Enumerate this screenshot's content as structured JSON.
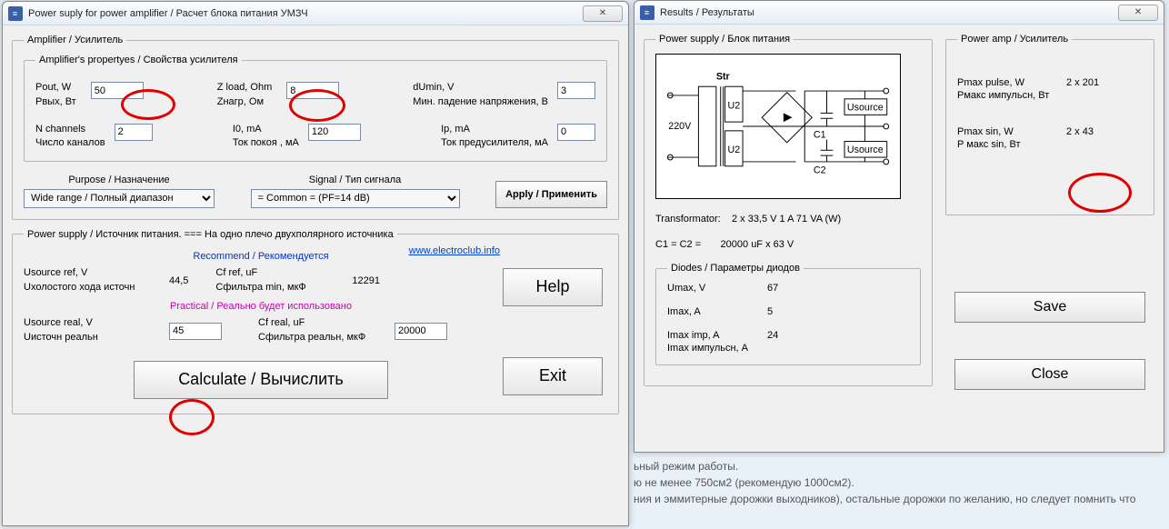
{
  "bg": {
    "line1": "ьный режим работы.",
    "line2": "ю не менее 750см2 (рекомендую 1000см2).",
    "line3": "ния и эммитерные дорожки выходников), остальные дорожки по желанию, но следует помнить что"
  },
  "win1": {
    "title": "Power suply for power amplifier / Расчет блока питания УМЗЧ",
    "close": "✕",
    "amp": {
      "legend": "Amplifier / Усилитель",
      "props_legend": "Amplifier's propertyes / Свойства усилителя",
      "pout_l1": "Pout, W",
      "pout_l2": "Pвых, Вт",
      "pout_val": "50",
      "zload_l1": "Z load, Ohm",
      "zload_l2": "Zнагр, Ом",
      "zload_val": "8",
      "dumin_l1": "dUmin, V",
      "dumin_l2": "Мин. падение напряжения, В",
      "dumin_val": "3",
      "nch_l1": "N channels",
      "nch_l2": "Число каналов",
      "nch_val": "2",
      "i0_l1": "I0, mA",
      "i0_l2": "Ток покоя , мА",
      "i0_val": "120",
      "ip_l1": "Ip, mA",
      "ip_l2": "Ток предусилителя, мА",
      "ip_val": "0",
      "purpose_lbl": "Purpose / Назначение",
      "purpose_sel": "Wide range / Полный диапазон",
      "signal_lbl": "Signal / Тип сигнала",
      "signal_sel": "= Common =   (PF=14 dB)",
      "apply": "Apply / Применить"
    },
    "ps": {
      "legend": "Power supply / Источник питания. ===  На одно плечо двухполярного источника",
      "link": "www.electroclub.info",
      "rec": "Recommend / Рекомендуется",
      "usrc_ref_l1": "Usource ref, V",
      "usrc_ref_l2": "Uхолостого хода источн",
      "usrc_ref_val": "44,5",
      "cf_ref_l1": "Cf ref, uF",
      "cf_ref_l2": "Cфильтра min, мкФ",
      "cf_ref_val": "12291",
      "prac": "Practical / Реально будет использовано",
      "usrc_real_l1": "Usource real, V",
      "usrc_real_l2": "Uисточн реальн",
      "usrc_real_val": "45",
      "cf_real_l1": "Cf real, uF",
      "cf_real_l2": "Cфильтра реальн, мкФ",
      "cf_real_val": "20000",
      "calc": "Calculate / Вычислить",
      "help": "Help",
      "exit": "Exit"
    }
  },
  "win2": {
    "title": "Results / Результаты",
    "close": "✕",
    "ps_legend": "Power supply / Блок питания",
    "schem": {
      "str": "Str",
      "u2a": "U2",
      "u2b": "U2",
      "v220": "220V",
      "c1": "C1",
      "c2": "C2",
      "us1": "Usource",
      "us2": "Usource"
    },
    "trans_l": "Transformator:",
    "trans_v": "2 x 33,5 V   1 A    71  VA (W)",
    "cap_l": "C1 = C2 =",
    "cap_v": "20000 uF  x  63 V",
    "diodes_legend": "Diodes / Параметры диодов",
    "umax_l": "Umax, V",
    "umax_v": "67",
    "imax_l": "Imax, A",
    "imax_v": "5",
    "imaximp_l1": "Imax imp, A",
    "imaximp_l2": "Imax импульсн, А",
    "imaximp_v": "24",
    "pamp_legend": "Power amp / Усилитель",
    "pmaxp_l1": "Pmax pulse, W",
    "pmaxp_l2": "Рмакс импульсн, Вт",
    "pmaxp_v": "2 x 201",
    "pmaxs_l1": "Pmax sin, W",
    "pmaxs_l2": "P макс sin, Вт",
    "pmaxs_v": "2 x 43",
    "save": "Save",
    "close_b": "Close"
  }
}
